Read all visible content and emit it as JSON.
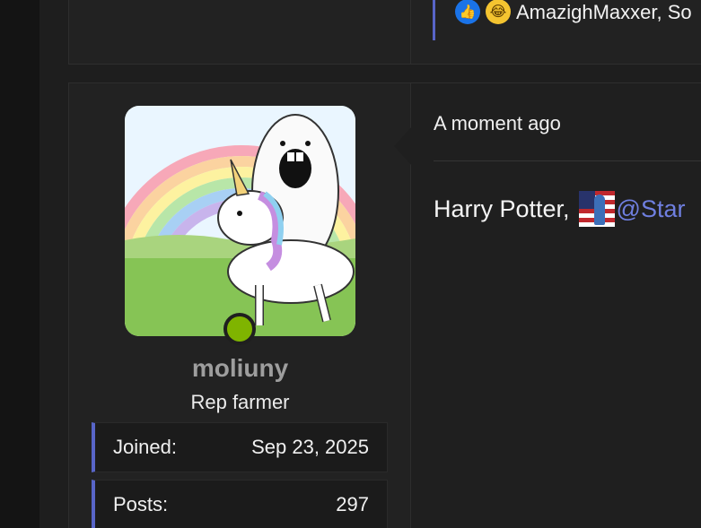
{
  "previous_post": {
    "reactions": {
      "icons": [
        "thumbs-up-icon",
        "laughing-emoji-icon"
      ],
      "names_text": "AmazighMaxxer, So"
    }
  },
  "post": {
    "author": {
      "username": "moliuny",
      "title": "Rep farmer",
      "online": true,
      "stats": [
        {
          "label": "Joined:",
          "value": "Sep 23, 2025"
        },
        {
          "label": "Posts:",
          "value": "297"
        }
      ]
    },
    "time": "A moment ago",
    "body_text": "Harry Potter,",
    "mention": "@Star"
  },
  "colors": {
    "accent": "#5865c8",
    "online": "#7fb400",
    "mention": "#6f7fe0",
    "username": "#9e9e9e"
  }
}
